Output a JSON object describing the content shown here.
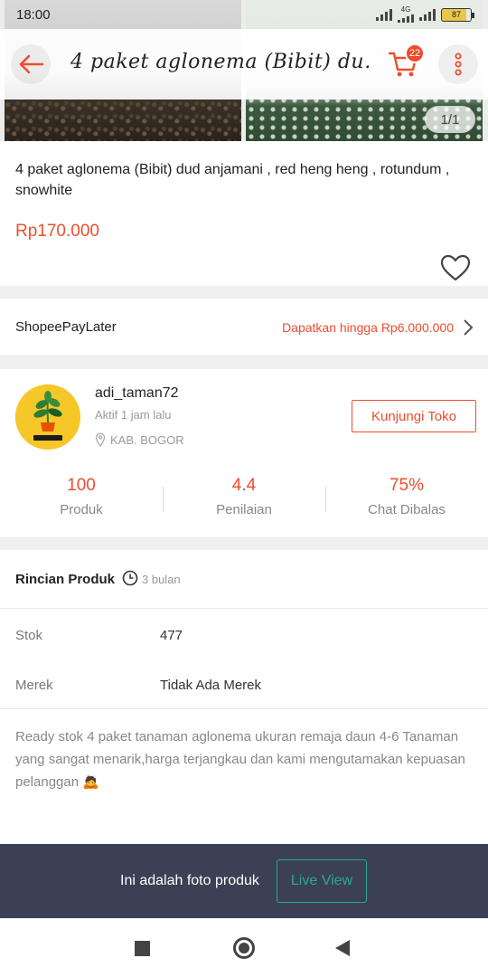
{
  "status_bar": {
    "time": "18:00",
    "network": "4G",
    "battery": "87"
  },
  "header": {
    "title": "4 paket aglonema (Bibit) du‥",
    "cart_count": "22",
    "image_counter": "1/1"
  },
  "product": {
    "title": "4 paket aglonema (Bibit) dud anjamani , red heng heng , rotundum , snowhite",
    "price": "Rp170.000"
  },
  "paylater": {
    "label": "ShopeePayLater",
    "offer": "Dapatkan hingga Rp6.000.000"
  },
  "shop": {
    "name": "adi_taman72",
    "active": "Aktif 1 jam lalu",
    "location": "KAB. BOGOR",
    "visit_label": "Kunjungi Toko",
    "stats": [
      {
        "value": "100",
        "label": "Produk"
      },
      {
        "value": "4.4",
        "label": "Penilaian"
      },
      {
        "value": "75%",
        "label": "Chat Dibalas"
      }
    ]
  },
  "details": {
    "title": "Rincian Produk",
    "age": "3 bulan",
    "rows": [
      {
        "label": "Stok",
        "value": "477"
      },
      {
        "label": "Merek",
        "value": "Tidak Ada Merek"
      }
    ],
    "description": "Ready stok 4 paket tanaman aglonema ukuran remaja daun 4-6 Tanaman yang sangat menarik,harga terjangkau dan kami mengutamakan kepuasan pelanggan 🙇"
  },
  "banner": {
    "text": "Ini adalah foto produk",
    "button_label": "Live View"
  },
  "colors": {
    "accent": "#ee4d2d",
    "teal": "#26aa99",
    "banner_bg": "#3b4054"
  },
  "icons": [
    "back-arrow-icon",
    "cart-icon",
    "more-vert-icon",
    "heart-icon",
    "chevron-right-icon",
    "location-pin-icon",
    "clock-icon",
    "recent-apps-icon",
    "home-icon",
    "back-icon"
  ]
}
